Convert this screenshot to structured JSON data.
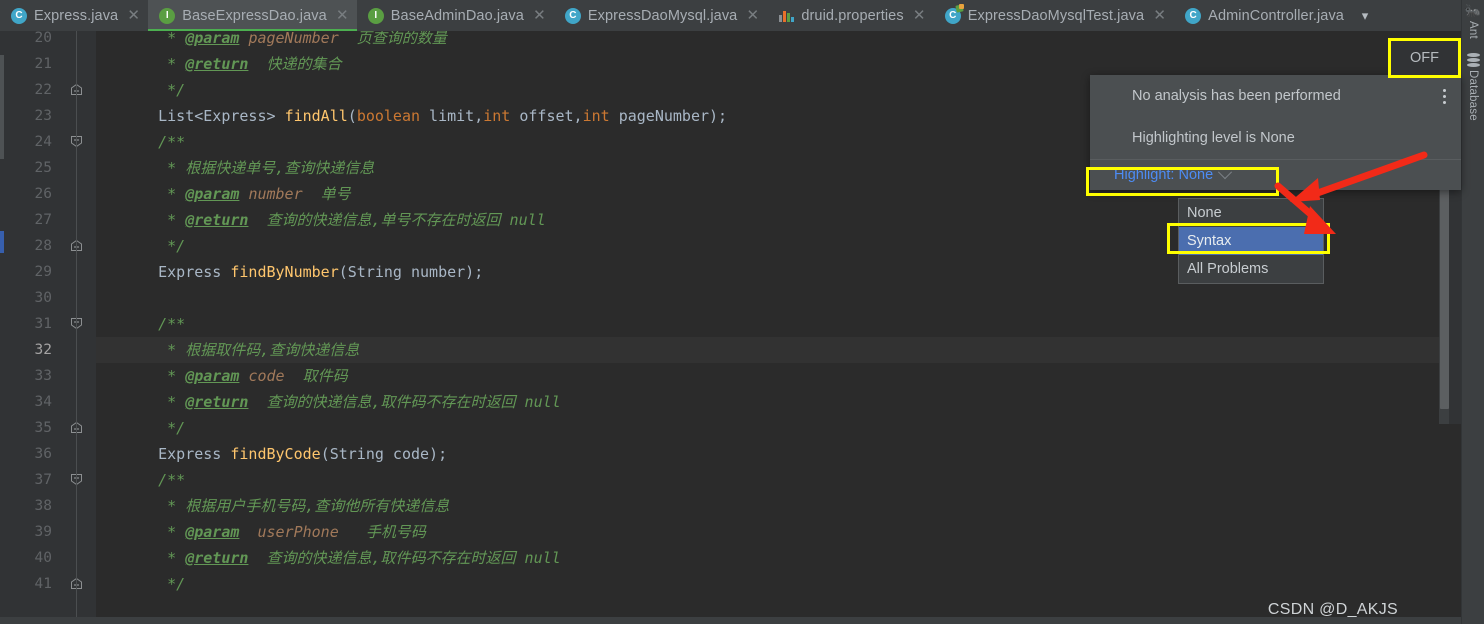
{
  "window": {
    "theme_bg": "#3c3f41",
    "editor_bg": "#2b2b2b",
    "accent_highlight": "#ffff00",
    "selection_blue": "#4b6eaf",
    "link_blue": "#4d8cf5"
  },
  "tabs": [
    {
      "label": "Express.java",
      "icon": "java-class-icon",
      "icon_kind": "cls",
      "active": false,
      "closable": true
    },
    {
      "label": "BaseExpressDao.java",
      "icon": "java-interface-icon",
      "icon_kind": "iface",
      "active": true,
      "closable": true
    },
    {
      "label": "BaseAdminDao.java",
      "icon": "java-interface-icon",
      "icon_kind": "iface",
      "active": false,
      "closable": true
    },
    {
      "label": "ExpressDaoMysql.java",
      "icon": "java-class-icon",
      "icon_kind": "cls",
      "active": false,
      "closable": true
    },
    {
      "label": "druid.properties",
      "icon": "properties-file-icon",
      "icon_kind": "props",
      "active": false,
      "closable": true
    },
    {
      "label": "ExpressDaoMysqlTest.java",
      "icon": "java-test-class-icon",
      "icon_kind": "test",
      "active": false,
      "closable": true
    },
    {
      "label": "AdminController.java",
      "icon": "java-class-icon",
      "icon_kind": "cls",
      "active": false,
      "closable": false
    }
  ],
  "tab_overflow_icon": "chevron-down-icon",
  "right_tool_strip": [
    {
      "label": "Ant",
      "icon": "ant-icon"
    },
    {
      "label": "Database",
      "icon": "database-icon"
    }
  ],
  "editor": {
    "first_line": 20,
    "caret_line": 32,
    "lines": [
      {
        "n": 20,
        "tokens": [
          {
            "t": "     * ",
            "c": "cmt"
          },
          {
            "t": "@param",
            "c": "cmt-tag"
          },
          {
            "t": " ",
            "c": "cmt"
          },
          {
            "t": "pageNumber",
            "c": "cmt-par"
          },
          {
            "t": "  页查询的数量",
            "c": "cmt"
          }
        ]
      },
      {
        "n": 21,
        "tokens": [
          {
            "t": "     * ",
            "c": "cmt"
          },
          {
            "t": "@return",
            "c": "cmt-tag"
          },
          {
            "t": "  快递的集合",
            "c": "cmt"
          }
        ]
      },
      {
        "n": 22,
        "tokens": [
          {
            "t": "     */",
            "c": "cmt"
          }
        ]
      },
      {
        "n": 23,
        "tokens": [
          {
            "t": "    List<Express> ",
            "c": "ident"
          },
          {
            "t": "findAll",
            "c": "meth"
          },
          {
            "t": "(",
            "c": "punct"
          },
          {
            "t": "boolean",
            "c": "kw"
          },
          {
            "t": " limit,",
            "c": "ident"
          },
          {
            "t": "int",
            "c": "kw"
          },
          {
            "t": " offset,",
            "c": "ident"
          },
          {
            "t": "int",
            "c": "kw"
          },
          {
            "t": " pageNumber);",
            "c": "ident"
          }
        ]
      },
      {
        "n": 24,
        "tokens": [
          {
            "t": "    /**",
            "c": "cmt"
          }
        ]
      },
      {
        "n": 25,
        "tokens": [
          {
            "t": "     * 根据快递单号,查询快递信息",
            "c": "cmt"
          }
        ]
      },
      {
        "n": 26,
        "tokens": [
          {
            "t": "     * ",
            "c": "cmt"
          },
          {
            "t": "@param",
            "c": "cmt-tag"
          },
          {
            "t": " ",
            "c": "cmt"
          },
          {
            "t": "number",
            "c": "cmt-par"
          },
          {
            "t": "  单号",
            "c": "cmt"
          }
        ]
      },
      {
        "n": 27,
        "tokens": [
          {
            "t": "     * ",
            "c": "cmt"
          },
          {
            "t": "@return",
            "c": "cmt-tag"
          },
          {
            "t": "  查询的快递信息,单号不存在时返回 null",
            "c": "cmt"
          }
        ]
      },
      {
        "n": 28,
        "tokens": [
          {
            "t": "     */",
            "c": "cmt"
          }
        ]
      },
      {
        "n": 29,
        "tokens": [
          {
            "t": "    Express ",
            "c": "ident"
          },
          {
            "t": "findByNumber",
            "c": "meth"
          },
          {
            "t": "(",
            "c": "punct"
          },
          {
            "t": "String number);",
            "c": "ident"
          }
        ]
      },
      {
        "n": 30,
        "tokens": []
      },
      {
        "n": 31,
        "tokens": [
          {
            "t": "    /**",
            "c": "cmt"
          }
        ]
      },
      {
        "n": 32,
        "tokens": [
          {
            "t": "     * 根据取件码,查询快递信息",
            "c": "cmt"
          }
        ]
      },
      {
        "n": 33,
        "tokens": [
          {
            "t": "     * ",
            "c": "cmt"
          },
          {
            "t": "@param",
            "c": "cmt-tag"
          },
          {
            "t": " ",
            "c": "cmt"
          },
          {
            "t": "code",
            "c": "cmt-par"
          },
          {
            "t": "  取件码",
            "c": "cmt"
          }
        ]
      },
      {
        "n": 34,
        "tokens": [
          {
            "t": "     * ",
            "c": "cmt"
          },
          {
            "t": "@return",
            "c": "cmt-tag"
          },
          {
            "t": "  查询的快递信息,取件码不存在时返回 null",
            "c": "cmt"
          }
        ]
      },
      {
        "n": 35,
        "tokens": [
          {
            "t": "     */",
            "c": "cmt"
          }
        ]
      },
      {
        "n": 36,
        "tokens": [
          {
            "t": "    Express ",
            "c": "ident"
          },
          {
            "t": "findByCode",
            "c": "meth"
          },
          {
            "t": "(",
            "c": "punct"
          },
          {
            "t": "String code);",
            "c": "ident"
          }
        ]
      },
      {
        "n": 37,
        "tokens": [
          {
            "t": "    /**",
            "c": "cmt"
          }
        ]
      },
      {
        "n": 38,
        "tokens": [
          {
            "t": "     * 根据用户手机号码,查询他所有快递信息",
            "c": "cmt"
          }
        ]
      },
      {
        "n": 39,
        "tokens": [
          {
            "t": "     * ",
            "c": "cmt"
          },
          {
            "t": "@param",
            "c": "cmt-tag"
          },
          {
            "t": "  ",
            "c": "cmt"
          },
          {
            "t": "userPhone",
            "c": "cmt-par"
          },
          {
            "t": "   手机号码",
            "c": "cmt"
          }
        ]
      },
      {
        "n": 40,
        "tokens": [
          {
            "t": "     * ",
            "c": "cmt"
          },
          {
            "t": "@return",
            "c": "cmt-tag"
          },
          {
            "t": "  查询的快递信息,取件码不存在时返回 null",
            "c": "cmt"
          }
        ]
      },
      {
        "n": 41,
        "tokens": [
          {
            "t": "     */",
            "c": "cmt"
          }
        ]
      }
    ]
  },
  "inspection_popup": {
    "status_text": "No analysis has been performed",
    "level_text": "Highlighting level is None",
    "highlight_label": "Highlight: None",
    "highlight_chevron_icon": "chevron-down-icon",
    "kebab_icon": "more-options-icon"
  },
  "highlight_dropdown": {
    "options": [
      "None",
      "Syntax",
      "All Problems"
    ],
    "selected": "Syntax"
  },
  "inspection_toggle": {
    "label": "OFF"
  },
  "watermark": "CSDN @D_AKJS"
}
